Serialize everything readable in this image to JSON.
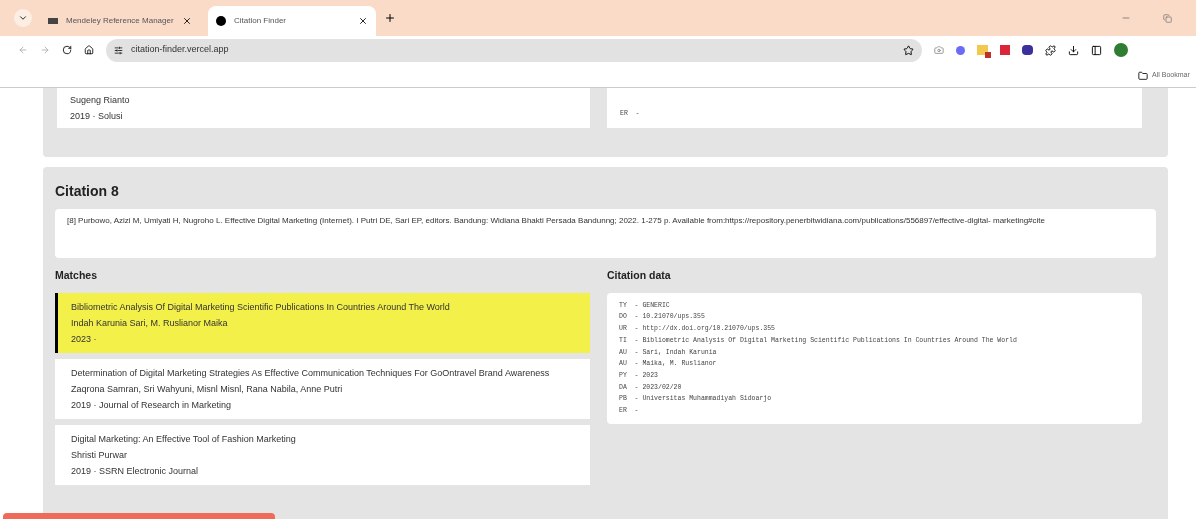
{
  "browser": {
    "tabs": [
      {
        "title": "Mendeley Reference Manager",
        "selected": false
      },
      {
        "title": "Citation Finder",
        "selected": true
      }
    ],
    "url": "citation-finder.vercel.app",
    "bookmarks_label": "All Bookmar"
  },
  "previous_citation": {
    "match": {
      "authors": "Sugeng Rianto",
      "meta": "2019 · Solusi"
    },
    "data_lines": [
      "ER  -"
    ]
  },
  "citation": {
    "title": "Citation 8",
    "text": "[8]   Purbowo, Azizi M, Umiyati H, Nugroho L. Effective Digital Marketing (Internet). I Putri DE, Sari EP, editors. Bandung: Widiana Bhakti Persada Bandunng; 2022. 1-275 p. Available from:https://repository.penerbitwidiana.com/publications/556897/effective-digital- marketing#cite",
    "matches_heading": "Matches",
    "data_heading": "Citation data",
    "matches": [
      {
        "title": "Bibliometric Analysis Of Digital Marketing Scientific Publications In Countries Around The World",
        "authors": "Indah Karunia Sari, M. Ruslianor Maika",
        "meta": "2023 ·",
        "selected": true
      },
      {
        "title": "Determination of Digital Marketing Strategies As Effective Communication Techniques For GoOntravel Brand Awareness",
        "authors": "Zaqrona Samran, Sri Wahyuni, Misnl Misnl, Rana Nabila, Anne Putri",
        "meta": "2019 · Journal of Research in Marketing",
        "selected": false
      },
      {
        "title": "Digital Marketing: An Effective Tool of Fashion Marketing",
        "authors": "Shristi Purwar",
        "meta": "2019 · SSRN Electronic Journal",
        "selected": false
      }
    ],
    "data_lines": [
      "TY  - GENERIC",
      "DO  - 10.21070/ups.355",
      "UR  - http://dx.doi.org/10.21070/ups.355",
      "TI  - Bibliometric Analysis Of Digital Marketing Scientific Publications In Countries Around The World",
      "AU  - Sari, Indah Karunia",
      "AU  - Maika, M. Ruslianor",
      "PY  - 2023",
      "DA  - 2023/02/20",
      "PB  - Universitas Muhammadiyah Sidoarjo",
      "ER  -"
    ]
  }
}
